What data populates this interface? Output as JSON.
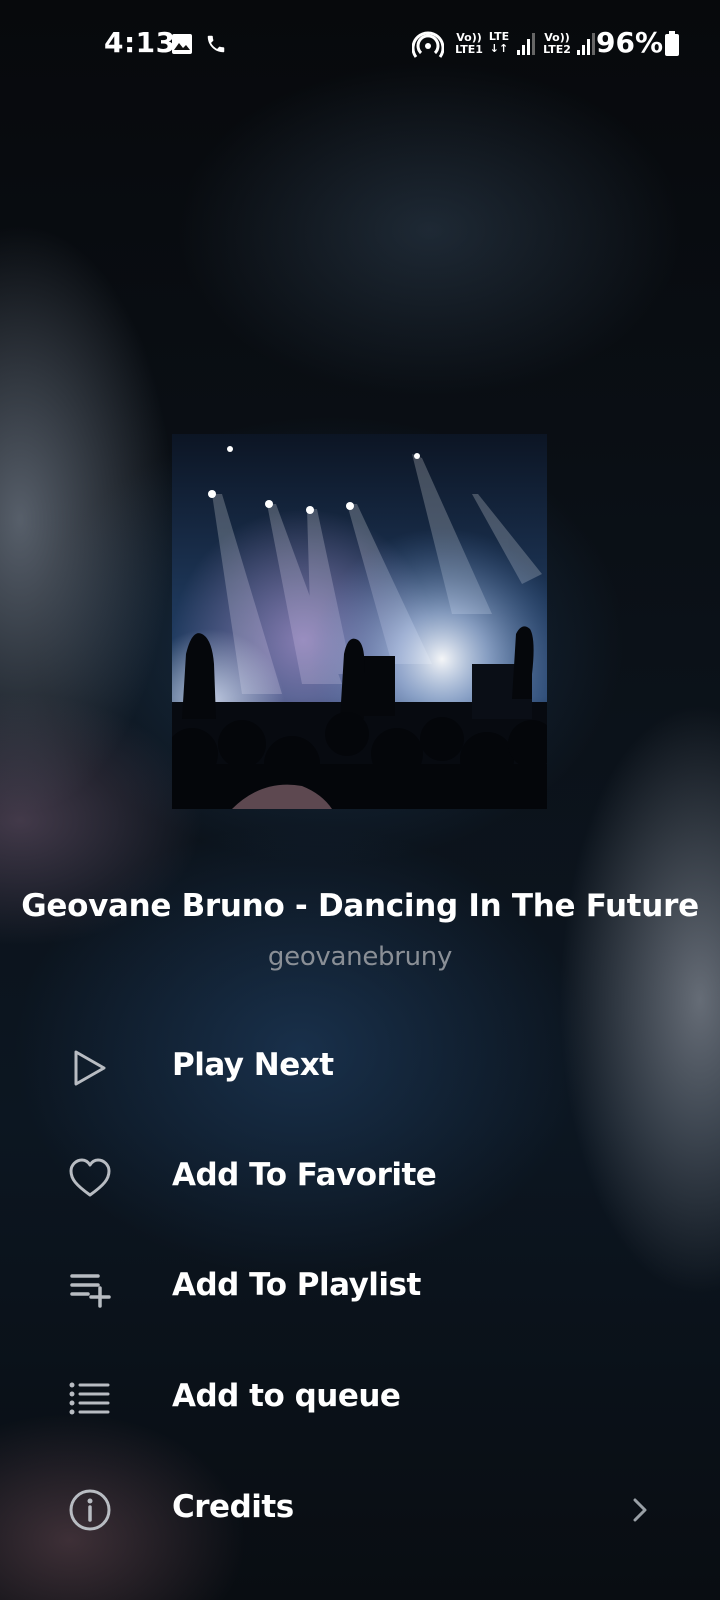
{
  "status_bar": {
    "time": "4:13",
    "sim1_top": "Vo))",
    "sim1_bottom": "LTE1",
    "lte_top": "LTE",
    "lte_bottom": "↓↑",
    "sim2_top": "Vo))",
    "sim2_bottom": "LTE2",
    "battery": "96%",
    "icons": [
      "gallery-icon",
      "phone-icon",
      "hotspot-icon",
      "signal-icon",
      "signal-icon",
      "battery-icon"
    ]
  },
  "track": {
    "title": "Geovane Bruno - Dancing In The Future",
    "artist": "geovanebruny"
  },
  "menu": [
    {
      "label": "Play Next",
      "icon": "play-icon"
    },
    {
      "label": "Add To Favorite",
      "icon": "heart-icon"
    },
    {
      "label": "Add To Playlist",
      "icon": "playlist-add-icon"
    },
    {
      "label": "Add to queue",
      "icon": "queue-list-icon"
    },
    {
      "label": "Credits",
      "icon": "info-icon"
    }
  ],
  "colors": {
    "text": "#ffffff",
    "muted": "#8a8f96",
    "icon": "#b8bcc2"
  }
}
